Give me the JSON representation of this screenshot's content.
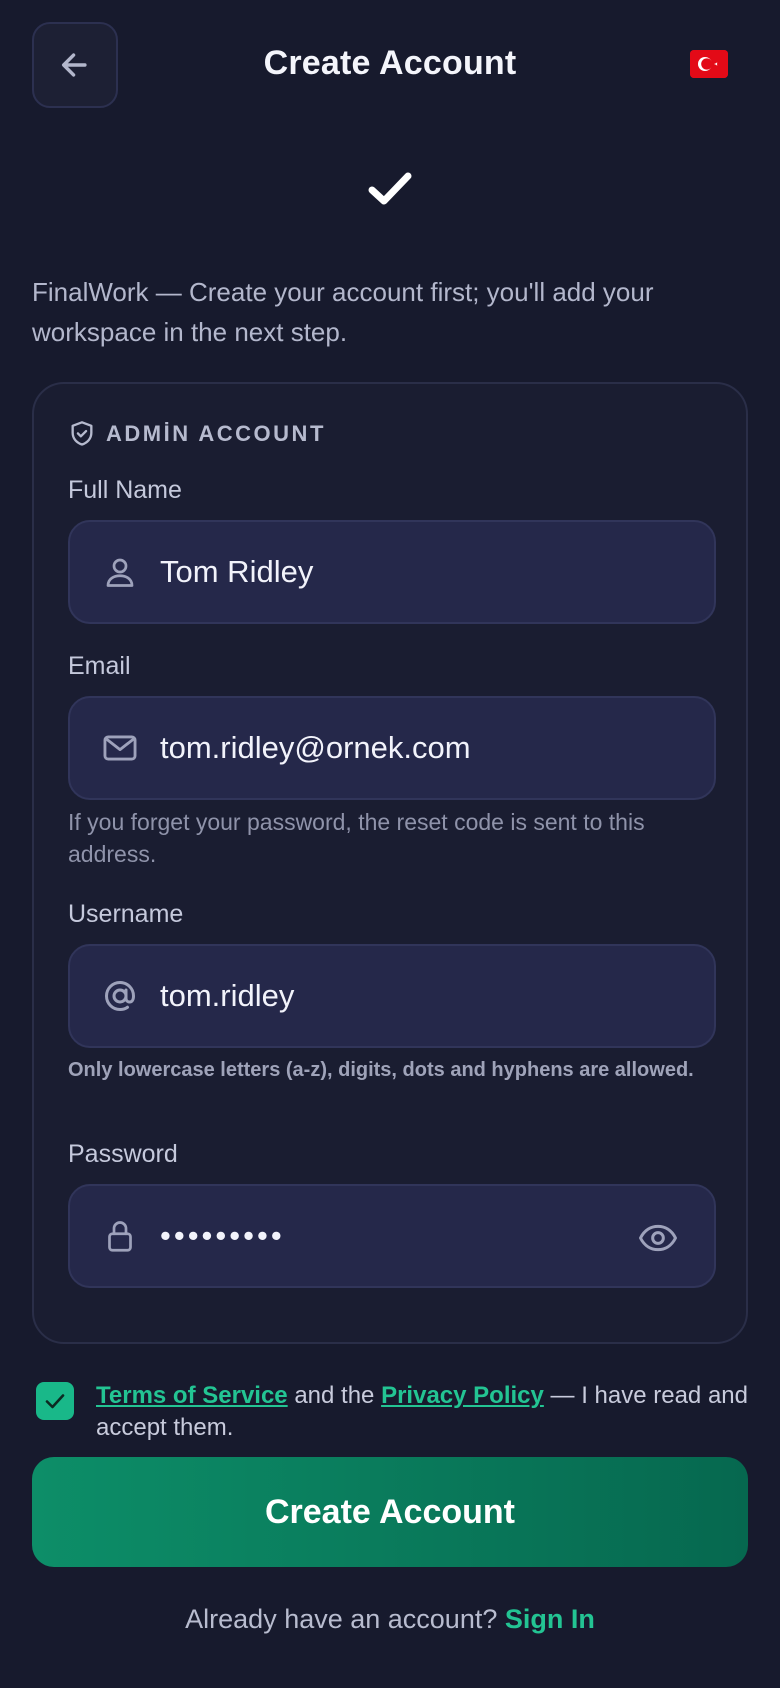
{
  "header": {
    "title": "Create Account",
    "back_icon": "arrow-left-icon",
    "language_flag": "turkey-flag-icon"
  },
  "intro_text": "FinalWork — Create your account first; you'll add your workspace in the next step.",
  "card": {
    "section_label": "ADMİN ACCOUNT",
    "section_icon": "shield-check-icon",
    "full_name": {
      "label": "Full Name",
      "value": "Tom Ridley",
      "icon": "user-icon"
    },
    "email": {
      "label": "Email",
      "value": "tom.ridley@ornek.com",
      "icon": "mail-icon",
      "hint": "If you forget your password, the reset code is sent to this address."
    },
    "username": {
      "label": "Username",
      "value": "tom.ridley",
      "icon": "at-icon",
      "hint": "Only lowercase letters (a-z), digits, dots and hyphens are allowed."
    },
    "password": {
      "label": "Password",
      "value": "•••••••••",
      "icon": "lock-icon",
      "toggle_icon": "eye-icon"
    }
  },
  "terms": {
    "checked": true,
    "terms_link": "Terms of Service",
    "middle": " and the ",
    "privacy_link": "Privacy Policy",
    "suffix": " — I have read and accept them."
  },
  "submit_label": "Create Account",
  "footer": {
    "prompt": "Already have an account? ",
    "signin_link": "Sign In"
  },
  "colors": {
    "background": "#171a2d",
    "accent": "#23c493",
    "button": "#0d8e68"
  }
}
